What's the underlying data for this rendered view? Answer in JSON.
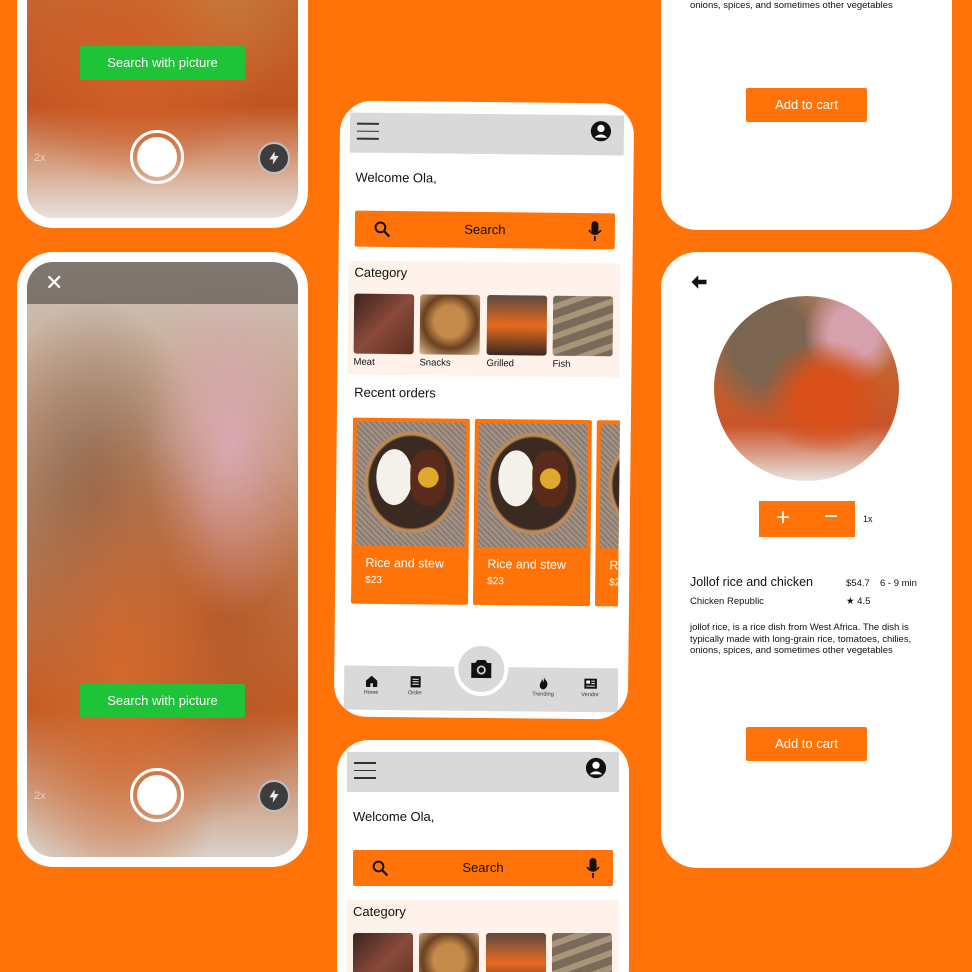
{
  "colors": {
    "brand": "#ff7308",
    "green": "#1ec337",
    "bg_light": "#fff2ea",
    "header_gray": "#d9d9d9"
  },
  "camera": {
    "search_btn_label": "Search with picture",
    "zoom": "2x",
    "close_icon": "close-icon",
    "flash_icon": "flash-icon"
  },
  "home": {
    "welcome": "Welcome Ola,",
    "search_label": "Search",
    "category_title": "Category",
    "categories": [
      {
        "label": "Meat"
      },
      {
        "label": "Snacks"
      },
      {
        "label": "Grilled"
      },
      {
        "label": "Fish"
      }
    ],
    "recent_orders_title": "Recent orders",
    "orders": [
      {
        "name": "Rice and stew",
        "price": "$23"
      },
      {
        "name": "Rice and stew",
        "price": "$23"
      },
      {
        "name": "Ri",
        "price": "$2"
      }
    ],
    "nav": [
      {
        "label": "Home",
        "icon": "home-icon"
      },
      {
        "label": "Order",
        "icon": "order-icon"
      },
      {
        "label": "Trending",
        "icon": "flame-icon"
      },
      {
        "label": "Vendor",
        "icon": "vendor-icon"
      }
    ]
  },
  "detail": {
    "desc_top": "is typically made with long-grain rice, tomatoes, chilies, onions, spices, and sometimes other vegetables",
    "add_to_cart": "Add to cart",
    "quantity": "1x",
    "dish_name": "Jollof rice and chicken",
    "price": "$54.7",
    "time": "6 - 9 min",
    "vendor": "Chicken Republic",
    "rating": "★ 4.5",
    "description": "jollof rice, is a rice dish from West Africa. The dish is typically made with long-grain rice, tomatoes, chilies, onions, spices, and sometimes other vegetables"
  }
}
